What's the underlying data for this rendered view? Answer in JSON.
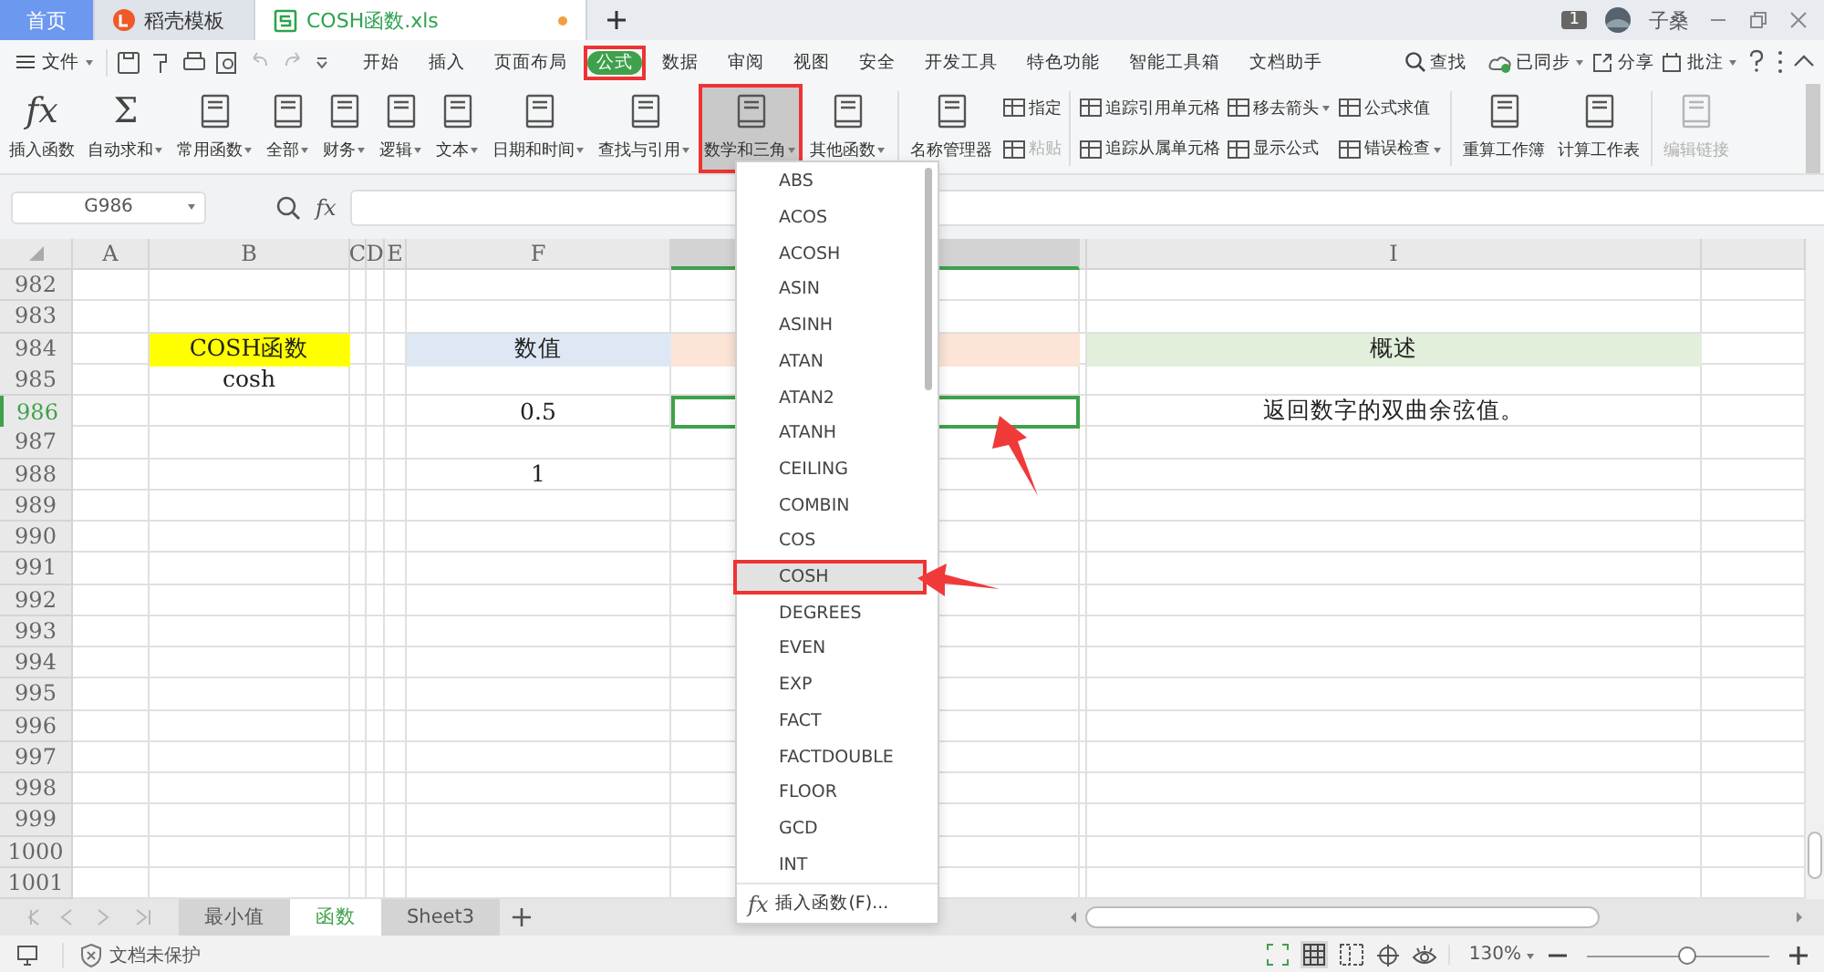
{
  "tabs": [
    {
      "kind": "home",
      "label": "首页",
      "selected": false,
      "modified": false
    },
    {
      "kind": "template",
      "label": "稻壳模板",
      "selected": false,
      "modified": false
    },
    {
      "kind": "sheet",
      "label": "COSH函数.xls",
      "selected": true,
      "modified": true
    }
  ],
  "account": {
    "badge": "1",
    "user": "子桑"
  },
  "menu": {
    "file": "文件",
    "tabs": [
      {
        "label": "开始",
        "selected": false,
        "highlighted": false
      },
      {
        "label": "插入",
        "selected": false,
        "highlighted": false
      },
      {
        "label": "页面布局",
        "selected": false,
        "highlighted": false
      },
      {
        "label": "公式",
        "selected": true,
        "highlighted": true
      },
      {
        "label": "数据",
        "selected": false,
        "highlighted": false
      },
      {
        "label": "审阅",
        "selected": false,
        "highlighted": false
      },
      {
        "label": "视图",
        "selected": false,
        "highlighted": false
      },
      {
        "label": "安全",
        "selected": false,
        "highlighted": false
      },
      {
        "label": "开发工具",
        "selected": false,
        "highlighted": false
      },
      {
        "label": "特色功能",
        "selected": false,
        "highlighted": false
      },
      {
        "label": "智能工具箱",
        "selected": false,
        "highlighted": false
      },
      {
        "label": "文档助手",
        "selected": false,
        "highlighted": false
      }
    ],
    "search": "查找",
    "sync": "已同步",
    "share": "分享",
    "comment": "批注"
  },
  "ribbon": {
    "items": [
      {
        "kind": "big",
        "label": "插入函数",
        "icon_text": "fx",
        "dropdown": false,
        "selected": false,
        "highlighted": false,
        "disabled": false
      },
      {
        "kind": "big",
        "label": "自动求和",
        "icon_text": "Σ",
        "dropdown": true,
        "selected": false,
        "highlighted": false,
        "disabled": false
      },
      {
        "kind": "big",
        "label": "常用函数",
        "dropdown": true,
        "selected": false,
        "highlighted": false,
        "disabled": false
      },
      {
        "kind": "big",
        "label": "全部",
        "dropdown": true,
        "selected": false,
        "highlighted": false,
        "disabled": false
      },
      {
        "kind": "big",
        "label": "财务",
        "dropdown": true,
        "selected": false,
        "highlighted": false,
        "disabled": false
      },
      {
        "kind": "big",
        "label": "逻辑",
        "dropdown": true,
        "selected": false,
        "highlighted": false,
        "disabled": false
      },
      {
        "kind": "big",
        "label": "文本",
        "dropdown": true,
        "selected": false,
        "highlighted": false,
        "disabled": false
      },
      {
        "kind": "big",
        "label": "日期和时间",
        "dropdown": true,
        "selected": false,
        "highlighted": false,
        "disabled": false
      },
      {
        "kind": "big",
        "label": "查找与引用",
        "dropdown": true,
        "selected": false,
        "highlighted": false,
        "disabled": false
      },
      {
        "kind": "big",
        "label": "数学和三角",
        "dropdown": true,
        "selected": true,
        "highlighted": true,
        "disabled": false
      },
      {
        "kind": "big",
        "label": "其他函数",
        "dropdown": true,
        "selected": false,
        "highlighted": false,
        "disabled": false
      },
      {
        "kind": "separator"
      },
      {
        "kind": "big",
        "label": "名称管理器",
        "dropdown": false,
        "selected": false,
        "highlighted": false,
        "disabled": false
      },
      {
        "kind": "stack",
        "items": [
          {
            "label": "指定",
            "dropdown": false,
            "disabled": false
          },
          {
            "label": "粘贴",
            "dropdown": false,
            "disabled": true
          }
        ]
      },
      {
        "kind": "separator"
      },
      {
        "kind": "stack",
        "items": [
          {
            "label": "追踪引用单元格",
            "dropdown": false,
            "disabled": false
          },
          {
            "label": "追踪从属单元格",
            "dropdown": false,
            "disabled": false
          }
        ]
      },
      {
        "kind": "stack",
        "items": [
          {
            "label": "移去箭头",
            "dropdown": true,
            "disabled": false
          },
          {
            "label": "显示公式",
            "dropdown": false,
            "disabled": false
          }
        ]
      },
      {
        "kind": "stack",
        "items": [
          {
            "label": "公式求值",
            "dropdown": false,
            "disabled": false
          },
          {
            "label": "错误检查",
            "dropdown": true,
            "disabled": false
          }
        ]
      },
      {
        "kind": "separator"
      },
      {
        "kind": "big",
        "label": "重算工作簿",
        "dropdown": false,
        "selected": false,
        "highlighted": false,
        "disabled": false
      },
      {
        "kind": "big",
        "label": "计算工作表",
        "dropdown": false,
        "selected": false,
        "highlighted": false,
        "disabled": false
      },
      {
        "kind": "separator"
      },
      {
        "kind": "big",
        "label": "编辑链接",
        "dropdown": false,
        "selected": false,
        "highlighted": false,
        "disabled": true
      }
    ]
  },
  "formula_bar": {
    "name_box": "G986",
    "fx_label": "fx"
  },
  "sheet": {
    "columns": [
      {
        "label": "A",
        "selected": false
      },
      {
        "label": "B",
        "selected": false
      },
      {
        "label": "C",
        "selected": false
      },
      {
        "label": "D",
        "selected": false
      },
      {
        "label": "E",
        "selected": false
      },
      {
        "label": "F",
        "selected": false
      },
      {
        "selected": true
      },
      {
        "selected": false
      },
      {
        "label": "I",
        "selected": false
      },
      {
        "selected": false
      }
    ],
    "rows": [
      {
        "number": "982",
        "selected": false
      },
      {
        "number": "983",
        "selected": false
      },
      {
        "number": "984",
        "selected": false,
        "cells": [
          {},
          {
            "text": "COSH函数",
            "color": "#ffff00"
          },
          {},
          {},
          {},
          {
            "text": "数值",
            "color": "#dde8f4"
          },
          {
            "color": "#fce4d6"
          },
          {},
          {
            "text": "概述",
            "color": "#e2efda"
          },
          {}
        ]
      },
      {
        "number": "985",
        "selected": false,
        "cells": [
          {},
          {
            "text": "cosh"
          }
        ]
      },
      {
        "number": "986",
        "selected": true,
        "cells": [
          {},
          {},
          {},
          {},
          {},
          {
            "text": "0.5"
          },
          {},
          {},
          {
            "text": "返回数字的双曲余弦值。"
          },
          {}
        ]
      },
      {
        "number": "987",
        "selected": false
      },
      {
        "number": "988",
        "selected": false,
        "cells": [
          {},
          {},
          {},
          {},
          {},
          {
            "text": "1"
          }
        ]
      },
      {
        "number": "989",
        "selected": false
      },
      {
        "number": "990",
        "selected": false
      },
      {
        "number": "991",
        "selected": false
      },
      {
        "number": "992",
        "selected": false
      },
      {
        "number": "993",
        "selected": false
      },
      {
        "number": "994",
        "selected": false
      },
      {
        "number": "995",
        "selected": false
      },
      {
        "number": "996",
        "selected": false
      },
      {
        "number": "997",
        "selected": false
      },
      {
        "number": "998",
        "selected": false
      },
      {
        "number": "999",
        "selected": false
      },
      {
        "number": "1000",
        "selected": false
      },
      {
        "number": "1001",
        "selected": false
      }
    ]
  },
  "dropdown": {
    "items": [
      {
        "label": "ABS",
        "selected": false,
        "highlighted": false
      },
      {
        "label": "ACOS",
        "selected": false,
        "highlighted": false
      },
      {
        "label": "ACOSH",
        "selected": false,
        "highlighted": false
      },
      {
        "label": "ASIN",
        "selected": false,
        "highlighted": false
      },
      {
        "label": "ASINH",
        "selected": false,
        "highlighted": false
      },
      {
        "label": "ATAN",
        "selected": false,
        "highlighted": false
      },
      {
        "label": "ATAN2",
        "selected": false,
        "highlighted": false
      },
      {
        "label": "ATANH",
        "selected": false,
        "highlighted": false
      },
      {
        "label": "CEILING",
        "selected": false,
        "highlighted": false
      },
      {
        "label": "COMBIN",
        "selected": false,
        "highlighted": false
      },
      {
        "label": "COS",
        "selected": false,
        "highlighted": false
      },
      {
        "label": "COSH",
        "selected": true,
        "highlighted": true
      },
      {
        "label": "DEGREES",
        "selected": false,
        "highlighted": false
      },
      {
        "label": "EVEN",
        "selected": false,
        "highlighted": false
      },
      {
        "label": "EXP",
        "selected": false,
        "highlighted": false
      },
      {
        "label": "FACT",
        "selected": false,
        "highlighted": false
      },
      {
        "label": "FACTDOUBLE",
        "selected": false,
        "highlighted": false
      },
      {
        "label": "FLOOR",
        "selected": false,
        "highlighted": false
      },
      {
        "label": "GCD",
        "selected": false,
        "highlighted": false
      },
      {
        "label": "INT",
        "selected": false,
        "highlighted": false
      }
    ],
    "footer_icon": "fx",
    "footer": "插入函数(F)..."
  },
  "sheet_tabs": [
    {
      "label": "最小值",
      "selected": false
    },
    {
      "label": "函数",
      "selected": true
    },
    {
      "label": "Sheet3",
      "selected": false
    }
  ],
  "status": {
    "protection": "文档未保护",
    "zoom": "130%",
    "zoom_slider": {
      "level": 0.55
    }
  }
}
